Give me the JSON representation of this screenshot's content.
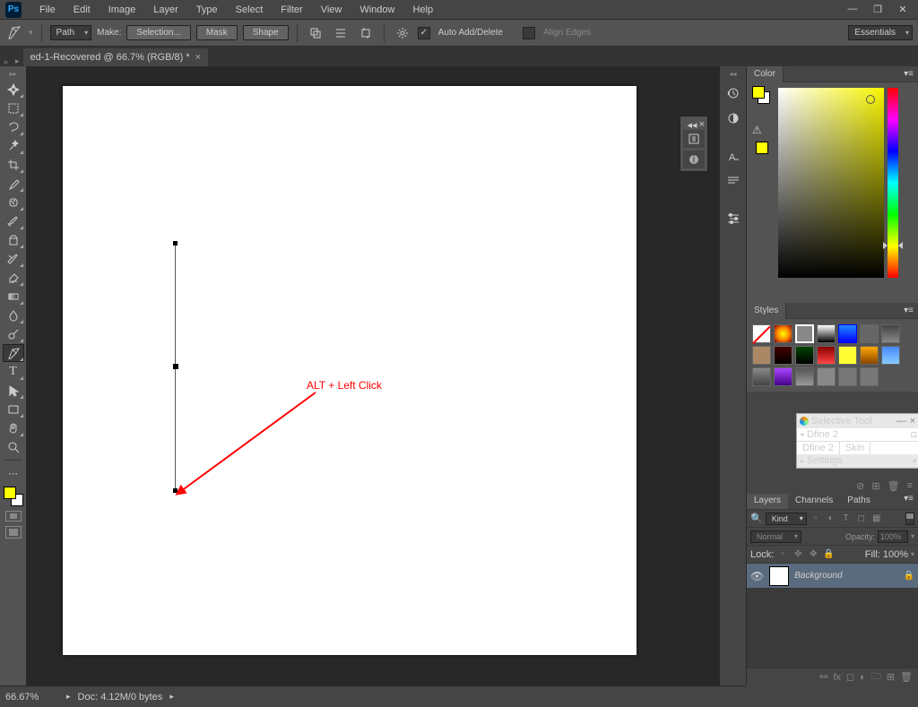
{
  "app": {
    "logo": "Ps"
  },
  "menu": [
    "File",
    "Edit",
    "Image",
    "Layer",
    "Type",
    "Select",
    "Filter",
    "View",
    "Window",
    "Help"
  ],
  "options": {
    "mode": "Path",
    "make_label": "Make:",
    "selection_btn": "Selection...",
    "mask_btn": "Mask",
    "shape_btn": "Shape",
    "auto_add_delete": "Auto Add/Delete",
    "align_edges": "Align Edges",
    "workspace": "Essentials"
  },
  "document": {
    "tab_title": "ed-1-Recovered @ 66.7% (RGB/8) *"
  },
  "annotation": "ALT + Left Click",
  "selective_tool": {
    "title": "Selective Tool",
    "row1": "Dfine 2",
    "tab1": "Dfine 2",
    "tab2": "Skin",
    "settings": "Settings"
  },
  "panels": {
    "color_tab": "Color",
    "styles_tab": "Styles",
    "layers_tab": "Layers",
    "channels_tab": "Channels",
    "paths_tab": "Paths",
    "kind": "Kind",
    "blend_mode": "Normal",
    "opacity_label": "Opacity:",
    "opacity_value": "100%",
    "lock_label": "Lock:",
    "fill_label": "Fill:",
    "fill_value": "100%",
    "layer_name": "Background"
  },
  "status": {
    "zoom": "66.67%",
    "doc": "Doc: 4.12M/0 bytes"
  }
}
